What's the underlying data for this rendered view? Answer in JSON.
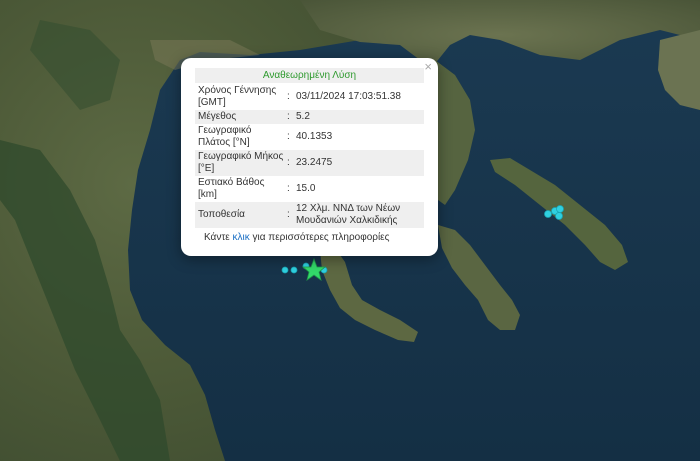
{
  "map": {
    "epicenter_icon": "star-icon",
    "event_marker_color": "#2fd0e0",
    "epicenter_color": "#33d96a"
  },
  "popup": {
    "title": "Αναθεωρημένη Λύση",
    "title_color": "#2e9a2e",
    "close_icon": "close-icon",
    "rows": [
      {
        "label": "Χρόνος Γέννησης [GMT]",
        "value": "03/11/2024 17:03:51.38"
      },
      {
        "label": "Μέγεθος",
        "value": "5.2"
      },
      {
        "label": "Γεωγραφικό Πλάτος [°N]",
        "value": "40.1353"
      },
      {
        "label": "Γεωγραφικό Μήκος [°E]",
        "value": "23.2475"
      },
      {
        "label": "Εστιακό Βάθος [km]",
        "value": "15.0"
      },
      {
        "label": "Τοποθεσία",
        "value": "12 Χλμ. ΝΝΔ των Νέων Μουδανιών Χαλκιδικής"
      }
    ],
    "more_prefix": "Κάντε ",
    "more_link": "κλικ",
    "more_suffix": " για περισσότερες πληροφορίες"
  }
}
